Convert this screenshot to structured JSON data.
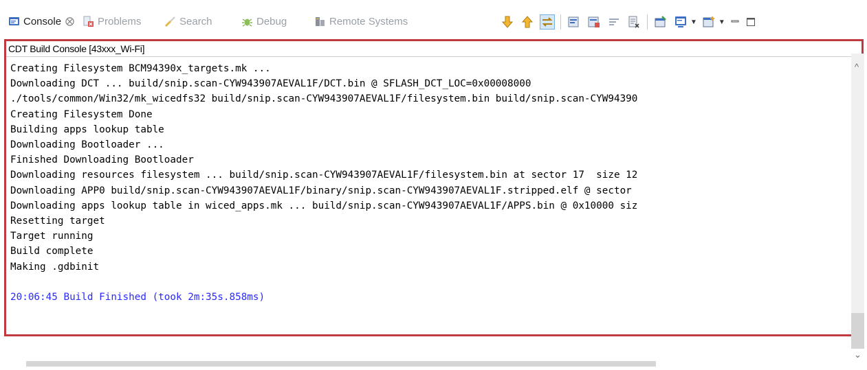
{
  "tabs": [
    {
      "label": "Console",
      "active": true,
      "icon": "console-icon",
      "close": "⨂"
    },
    {
      "label": "Problems",
      "active": false,
      "icon": "problems-icon"
    },
    {
      "label": "Search",
      "active": false,
      "icon": "search-icon"
    },
    {
      "label": "Debug",
      "active": false,
      "icon": "debug-icon"
    },
    {
      "label": "Remote Systems",
      "active": false,
      "icon": "remote-systems-icon"
    }
  ],
  "toolbar": {
    "icons": [
      "scroll-down-icon",
      "scroll-up-icon",
      "scroll-lock-icon",
      "show-on-output-icon",
      "show-on-error-icon",
      "word-wrap-icon",
      "clear-console-icon",
      "pin-console-icon",
      "display-console-icon",
      "open-console-icon",
      "minimize-icon",
      "maximize-icon"
    ]
  },
  "console": {
    "title": "CDT Build Console [43xxx_Wi-Fi]",
    "lines": [
      "Creating Filesystem BCM94390x_targets.mk ...",
      "Downloading DCT ... build/snip.scan-CYW943907AEVAL1F/DCT.bin @ SFLASH_DCT_LOC=0x00008000",
      "./tools/common/Win32/mk_wicedfs32 build/snip.scan-CYW943907AEVAL1F/filesystem.bin build/snip.scan-CYW94390",
      "Creating Filesystem Done",
      "Building apps lookup table",
      "Downloading Bootloader ...",
      "Finished Downloading Bootloader",
      "Downloading resources filesystem ... build/snip.scan-CYW943907AEVAL1F/filesystem.bin at sector 17  size 12",
      "Downloading APP0 build/snip.scan-CYW943907AEVAL1F/binary/snip.scan-CYW943907AEVAL1F.stripped.elf @ sector",
      "Downloading apps lookup table in wiced_apps.mk ... build/snip.scan-CYW943907AEVAL1F/APPS.bin @ 0x10000 siz",
      "Resetting target",
      "Target running",
      "Build complete",
      "Making .gdbinit",
      "",
      "20:06:45 Build Finished (took 2m:35s.858ms)"
    ]
  },
  "colors": {
    "frame": "#c0393f",
    "finished_text": "#2a2aff",
    "accent": "#3a6fc4"
  }
}
